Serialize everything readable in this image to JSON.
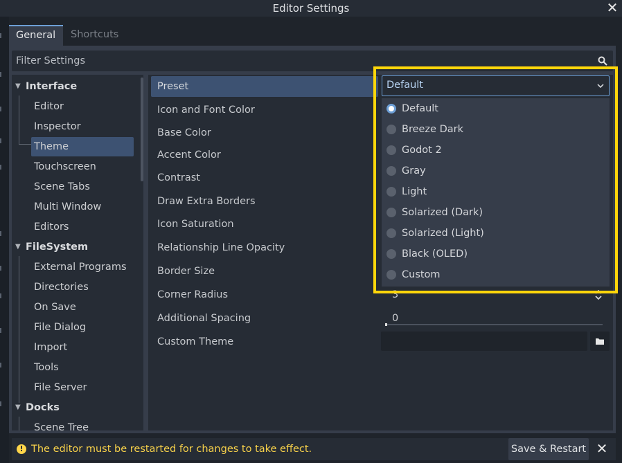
{
  "window": {
    "title": "Editor Settings",
    "close_label": "✕"
  },
  "tabs": [
    {
      "label": "General"
    },
    {
      "label": "Shortcuts"
    }
  ],
  "filter": {
    "placeholder": "Filter Settings"
  },
  "tree": {
    "items": [
      {
        "label": "Interface",
        "type": "category"
      },
      {
        "label": "Editor",
        "type": "leaf"
      },
      {
        "label": "Inspector",
        "type": "leaf"
      },
      {
        "label": "Theme",
        "type": "leaf",
        "selected": true
      },
      {
        "label": "Touchscreen",
        "type": "leaf"
      },
      {
        "label": "Scene Tabs",
        "type": "leaf"
      },
      {
        "label": "Multi Window",
        "type": "leaf"
      },
      {
        "label": "Editors",
        "type": "leaf"
      },
      {
        "label": "FileSystem",
        "type": "category"
      },
      {
        "label": "External Programs",
        "type": "leaf"
      },
      {
        "label": "Directories",
        "type": "leaf"
      },
      {
        "label": "On Save",
        "type": "leaf"
      },
      {
        "label": "File Dialog",
        "type": "leaf"
      },
      {
        "label": "Import",
        "type": "leaf"
      },
      {
        "label": "Tools",
        "type": "leaf"
      },
      {
        "label": "File Server",
        "type": "leaf"
      },
      {
        "label": "Docks",
        "type": "category"
      },
      {
        "label": "Scene Tree",
        "type": "leaf"
      }
    ]
  },
  "properties": [
    {
      "name": "Preset",
      "value": ""
    },
    {
      "name": "Icon and Font Color",
      "value": ""
    },
    {
      "name": "Base Color",
      "value": ""
    },
    {
      "name": "Accent Color",
      "value": ""
    },
    {
      "name": "Contrast",
      "value": ""
    },
    {
      "name": "Draw Extra Borders",
      "value": ""
    },
    {
      "name": "Icon Saturation",
      "value": ""
    },
    {
      "name": "Relationship Line Opacity",
      "value": ""
    },
    {
      "name": "Border Size",
      "value": ""
    },
    {
      "name": "Corner Radius",
      "value": "3"
    },
    {
      "name": "Additional Spacing",
      "value": "0"
    },
    {
      "name": "Custom Theme",
      "value": ""
    }
  ],
  "preset_dropdown": {
    "selected": "Default",
    "options": [
      {
        "label": "Default",
        "checked": true
      },
      {
        "label": "Breeze Dark",
        "checked": false
      },
      {
        "label": "Godot 2",
        "checked": false
      },
      {
        "label": "Gray",
        "checked": false
      },
      {
        "label": "Light",
        "checked": false
      },
      {
        "label": "Solarized (Dark)",
        "checked": false
      },
      {
        "label": "Solarized (Light)",
        "checked": false
      },
      {
        "label": "Black (OLED)",
        "checked": false
      },
      {
        "label": "Custom",
        "checked": false
      }
    ]
  },
  "status": {
    "warning_icon": "!",
    "message": "The editor must be restarted for changes to take effect.",
    "restart_label": "Save & Restart",
    "dismiss_label": "✕"
  },
  "colors": {
    "accent": "#6d9fd6",
    "highlight_border": "#ffd60a",
    "warning": "#f7d14a",
    "selection": "#3d5272"
  }
}
